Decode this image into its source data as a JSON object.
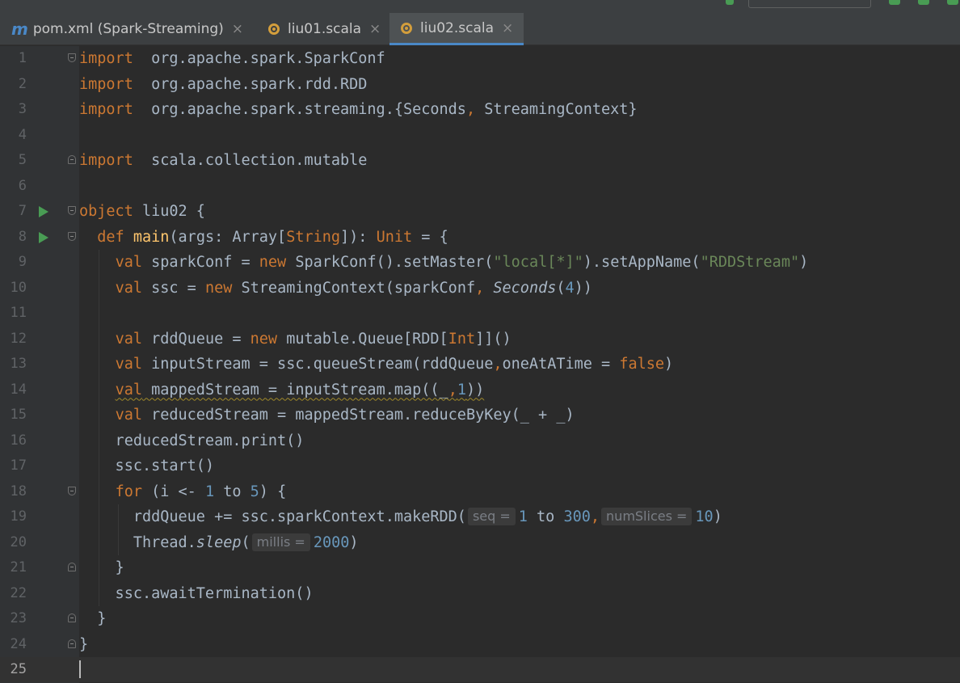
{
  "tabs": [
    {
      "icon": "maven-icon",
      "icon_text": "m",
      "label": "pom.xml (Spark-Streaming)",
      "active": false
    },
    {
      "icon": "scala-file-icon",
      "label": "liu01.scala",
      "active": false
    },
    {
      "icon": "scala-file-icon",
      "label": "liu02.scala",
      "active": true
    }
  ],
  "editor": {
    "current_line": 25,
    "lines": [
      {
        "n": "1",
        "tokens": [
          [
            "kw",
            "import"
          ],
          [
            "",
            "  org.apache.spark.SparkConf"
          ]
        ]
      },
      {
        "n": "2",
        "tokens": [
          [
            "kw",
            "import"
          ],
          [
            "",
            "  org.apache.spark.rdd.RDD"
          ]
        ]
      },
      {
        "n": "3",
        "tokens": [
          [
            "kw",
            "import"
          ],
          [
            "",
            "  org.apache.spark.streaming.{Seconds"
          ],
          [
            "kw",
            ","
          ],
          [
            "",
            " StreamingContext}"
          ]
        ]
      },
      {
        "n": "4",
        "tokens": []
      },
      {
        "n": "5",
        "tokens": [
          [
            "kw",
            "import"
          ],
          [
            "",
            "  scala.collection.mutable"
          ]
        ]
      },
      {
        "n": "6",
        "tokens": []
      },
      {
        "n": "7",
        "tokens": [
          [
            "kw",
            "object"
          ],
          [
            "",
            " liu02 {"
          ]
        ]
      },
      {
        "n": "8",
        "tokens": [
          [
            "",
            "  "
          ],
          [
            "kw",
            "def"
          ],
          [
            "",
            " "
          ],
          [
            "fn",
            "main"
          ],
          [
            "",
            "(args: Array["
          ],
          [
            "kw",
            "String"
          ],
          [
            "",
            "]): "
          ],
          [
            "kw",
            "Unit"
          ],
          [
            "",
            " = {"
          ]
        ]
      },
      {
        "n": "9",
        "tokens": [
          [
            "",
            "    "
          ],
          [
            "kw",
            "val"
          ],
          [
            "",
            " sparkConf = "
          ],
          [
            "kw",
            "new"
          ],
          [
            "",
            " SparkConf().setMaster("
          ],
          [
            "str",
            "\"local[*]\""
          ],
          [
            "",
            ").setAppName("
          ],
          [
            "str",
            "\"RDDStream\""
          ],
          [
            "",
            ")"
          ]
        ]
      },
      {
        "n": "10",
        "tokens": [
          [
            "",
            "    "
          ],
          [
            "kw",
            "val"
          ],
          [
            "",
            " ssc = "
          ],
          [
            "kw",
            "new"
          ],
          [
            "",
            " StreamingContext(sparkConf"
          ],
          [
            "kw",
            ","
          ],
          [
            "",
            " "
          ],
          [
            "it",
            "Seconds"
          ],
          [
            "",
            "("
          ],
          [
            "num",
            "4"
          ],
          [
            "",
            "))"
          ]
        ]
      },
      {
        "n": "11",
        "tokens": []
      },
      {
        "n": "12",
        "tokens": [
          [
            "",
            "    "
          ],
          [
            "kw",
            "val"
          ],
          [
            "",
            " rddQueue = "
          ],
          [
            "kw",
            "new"
          ],
          [
            "",
            " mutable.Queue[RDD["
          ],
          [
            "kw",
            "Int"
          ],
          [
            "",
            "]]()"
          ]
        ]
      },
      {
        "n": "13",
        "tokens": [
          [
            "",
            "    "
          ],
          [
            "kw",
            "val"
          ],
          [
            "",
            " inputStream = ssc.queueStream(rddQueue"
          ],
          [
            "kw",
            ","
          ],
          [
            "",
            "oneAtATime = "
          ],
          [
            "kw",
            "false"
          ],
          [
            "",
            ")"
          ]
        ]
      },
      {
        "n": "14",
        "tokens": [
          [
            "",
            "    "
          ],
          [
            "kw warn",
            "val"
          ],
          [
            "warn",
            " mappedStream = inputStream.map((_"
          ],
          [
            "kw warn",
            ","
          ],
          [
            "num warn",
            "1"
          ],
          [
            "warn",
            "))"
          ]
        ]
      },
      {
        "n": "15",
        "tokens": [
          [
            "",
            "    "
          ],
          [
            "kw",
            "val"
          ],
          [
            "",
            " reducedStream = mappedStream.reduceByKey(_ + _)"
          ]
        ]
      },
      {
        "n": "16",
        "tokens": [
          [
            "",
            "    reducedStream.print()"
          ]
        ]
      },
      {
        "n": "17",
        "tokens": [
          [
            "",
            "    ssc.start()"
          ]
        ]
      },
      {
        "n": "18",
        "tokens": [
          [
            "",
            "    "
          ],
          [
            "kw",
            "for"
          ],
          [
            "",
            " (i <- "
          ],
          [
            "num",
            "1"
          ],
          [
            "",
            " to "
          ],
          [
            "num",
            "5"
          ],
          [
            "",
            ") {"
          ]
        ]
      },
      {
        "n": "19",
        "tokens": [
          [
            "",
            "      rddQueue += ssc.sparkContext.makeRDD("
          ],
          [
            "hint",
            "seq ="
          ],
          [
            "num",
            "1"
          ],
          [
            "",
            " to "
          ],
          [
            "num",
            "300"
          ],
          [
            "kw",
            ","
          ],
          [
            "",
            ""
          ],
          [
            "hint",
            "numSlices ="
          ],
          [
            "num",
            "10"
          ],
          [
            "",
            ")"
          ]
        ]
      },
      {
        "n": "20",
        "tokens": [
          [
            "",
            "      Thread."
          ],
          [
            "it",
            "sleep"
          ],
          [
            "",
            "("
          ],
          [
            "hint",
            "millis ="
          ],
          [
            "num",
            "2000"
          ],
          [
            "",
            ")"
          ]
        ]
      },
      {
        "n": "21",
        "tokens": [
          [
            "",
            "    }"
          ]
        ]
      },
      {
        "n": "22",
        "tokens": [
          [
            "",
            "    ssc.awaitTermination()"
          ]
        ]
      },
      {
        "n": "23",
        "tokens": [
          [
            "",
            "  }"
          ]
        ]
      },
      {
        "n": "24",
        "tokens": [
          [
            "",
            "}"
          ]
        ]
      },
      {
        "n": "25",
        "tokens": []
      }
    ],
    "run_markers": [
      "7",
      "8"
    ],
    "fold_markers": {
      "1": "down",
      "5": "up",
      "7": "down",
      "8": "down",
      "18": "down",
      "21": "up",
      "23": "up",
      "24": "up"
    }
  },
  "colors": {
    "keyword": "#cc7832",
    "string": "#6a8759",
    "number": "#6897bb",
    "function": "#ffc66d",
    "text": "#a9b7c6"
  }
}
